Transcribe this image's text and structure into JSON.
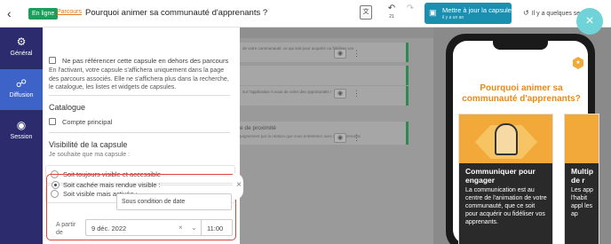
{
  "topbar": {
    "status": "En ligne",
    "parcours_link": "Parcours",
    "title": "Pourquoi animer sa communauté d'apprenants ?",
    "undo_count": "21",
    "update_button": "Mettre à jour la capsule",
    "update_sub": "il y a un an",
    "history": "Il y a quelques secon"
  },
  "nav": {
    "items": [
      {
        "label": "Général",
        "icon": "gear-icon"
      },
      {
        "label": "Diffusion",
        "icon": "share-icon"
      },
      {
        "label": "Session",
        "icon": "target-icon"
      }
    ]
  },
  "panel": {
    "no_reference_label": "Ne pas référencer cette capsule en dehors des parcours",
    "no_reference_desc": "En l'activant, votre capsule s'affichera uniquement dans la page des parcours associés. Elle ne s'affichera plus dans la recherche, le catalogue, les listes et widgets de capsules.",
    "catalogue_heading": "Catalogue",
    "compte_principal": "Compte principal",
    "visibility_heading": "Visibilité de la capsule",
    "visibility_hint": "Je souhaite que ma capsule :",
    "options": [
      "Soit toujours visible et accessible",
      "Soit visible mais activée :",
      "Soit cachée mais rendue visible :"
    ],
    "condition_value": "Sous condition de date",
    "a_partir_de": "A partir de",
    "date_value": "9 déc. 2022",
    "time_value": "11:00"
  },
  "editor": {
    "rows": [
      "de votre communauté, ce qui soit pour acquérir ou fidéliser vos",
      "",
      "sur l'application A vous de créer des opportunités !",
      ""
    ],
    "block_title": "e de proximité",
    "block_sub": "pagnement par la relation que vous entretenez avec vos apprenants"
  },
  "preview": {
    "title": "Pourquoi animer sa communauté d'apprenants?",
    "card1_title": "Communiquer pour engager",
    "card1_text": "La communication est au centre de l'animation de votre communauté, que ce soit pour acquérir ou fidéliser vos apprenants.",
    "card2_title": "Multip de r",
    "card2_text": "Les app l'habit appl les ap"
  },
  "colors": {
    "nav_bg": "#2b2b6e",
    "nav_active": "#3e63c8",
    "status_green": "#1b9e5a",
    "update_blue": "#1b8fb0",
    "accent_orange": "#e88a1a",
    "selected_red": "#e0423c"
  }
}
